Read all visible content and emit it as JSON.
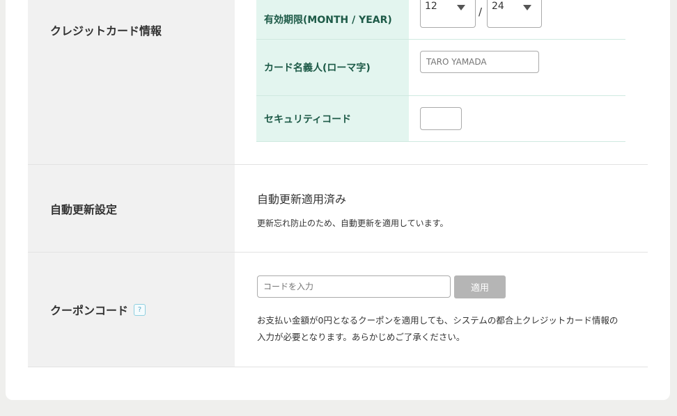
{
  "credit_card": {
    "section_label": "クレジットカード情報",
    "expiry": {
      "label": "有効期限(MONTH / YEAR)",
      "month": "12",
      "separator": "/",
      "year": "24"
    },
    "holder": {
      "label": "カード名義人(ローマ字)",
      "placeholder": "TARO YAMADA"
    },
    "security": {
      "label": "セキュリティコード",
      "value": ""
    }
  },
  "auto_renew": {
    "section_label": "自動更新設定",
    "status": "自動更新適用済み",
    "note": "更新忘れ防止のため、自動更新を適用しています。"
  },
  "coupon": {
    "section_label": "クーポンコード",
    "help": "?",
    "placeholder": "コードを入力",
    "apply_label": "適用",
    "note": "お支払い金額が0円となるクーポンを適用しても、システムの都合上クレジットカード情報の入力が必要となります。あらかじめご了承ください。"
  }
}
